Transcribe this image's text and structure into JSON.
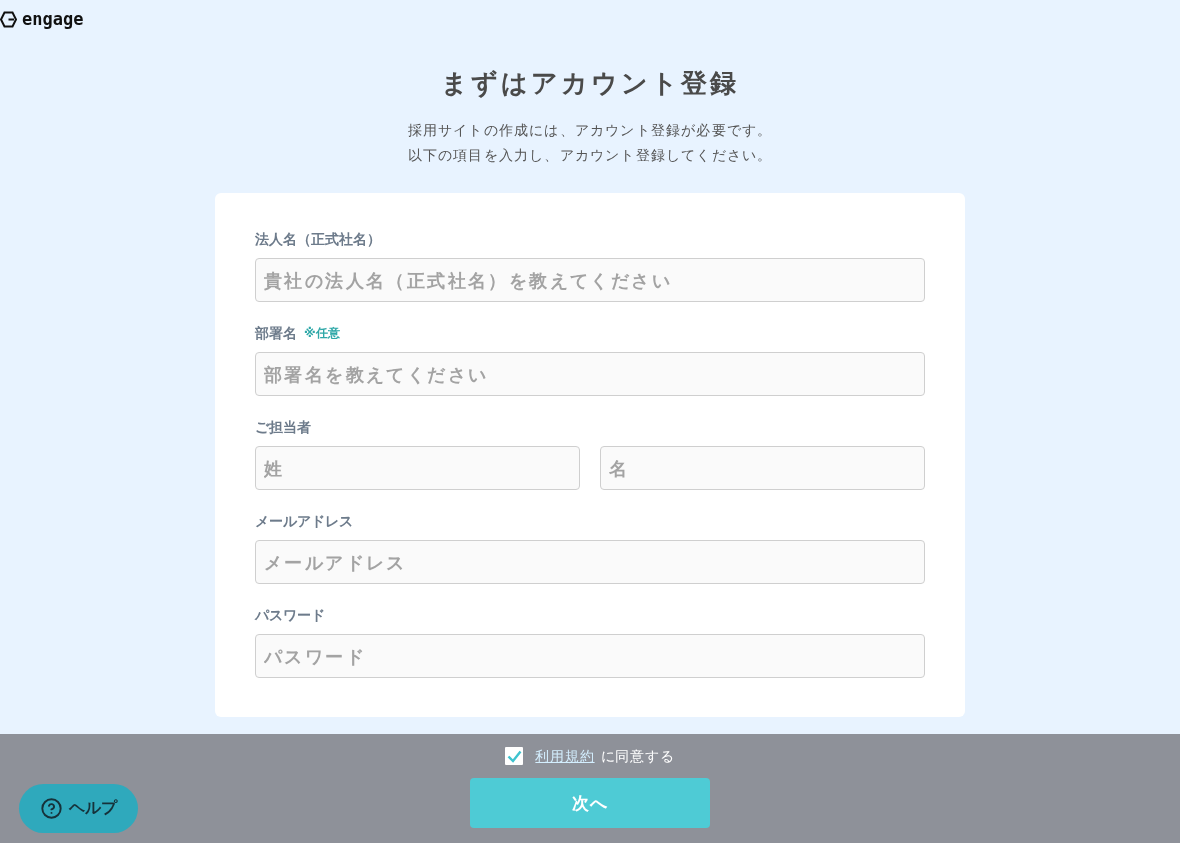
{
  "logo": {
    "text": "engage"
  },
  "heading": "まずはアカウント登録",
  "intro": [
    "採用サイトの作成には、アカウント登録が必要です。",
    "以下の項目を入力し、アカウント登録してください。"
  ],
  "form": {
    "fields": [
      {
        "label": "法人名（正式社名）",
        "inputs": [
          {
            "placeholder": "貴社の法人名（正式社名）を教えてください"
          }
        ]
      },
      {
        "label": "部署名",
        "note": "※任意",
        "inputs": [
          {
            "placeholder": "部署名を教えてください"
          }
        ]
      },
      {
        "label": "ご担当者",
        "inputs": [
          {
            "placeholder": "姓"
          },
          {
            "placeholder": "名"
          }
        ]
      },
      {
        "label": "メールアドレス",
        "inputs": [
          {
            "placeholder": "メールアドレス"
          }
        ]
      },
      {
        "label": "パスワード",
        "inputs": [
          {
            "placeholder": "パスワード"
          }
        ]
      }
    ]
  },
  "footer": {
    "agreement": {
      "checked": true,
      "link": "利用規約",
      "text": "に同意する"
    },
    "next_button": "次へ",
    "help_button": "ヘルプ"
  }
}
